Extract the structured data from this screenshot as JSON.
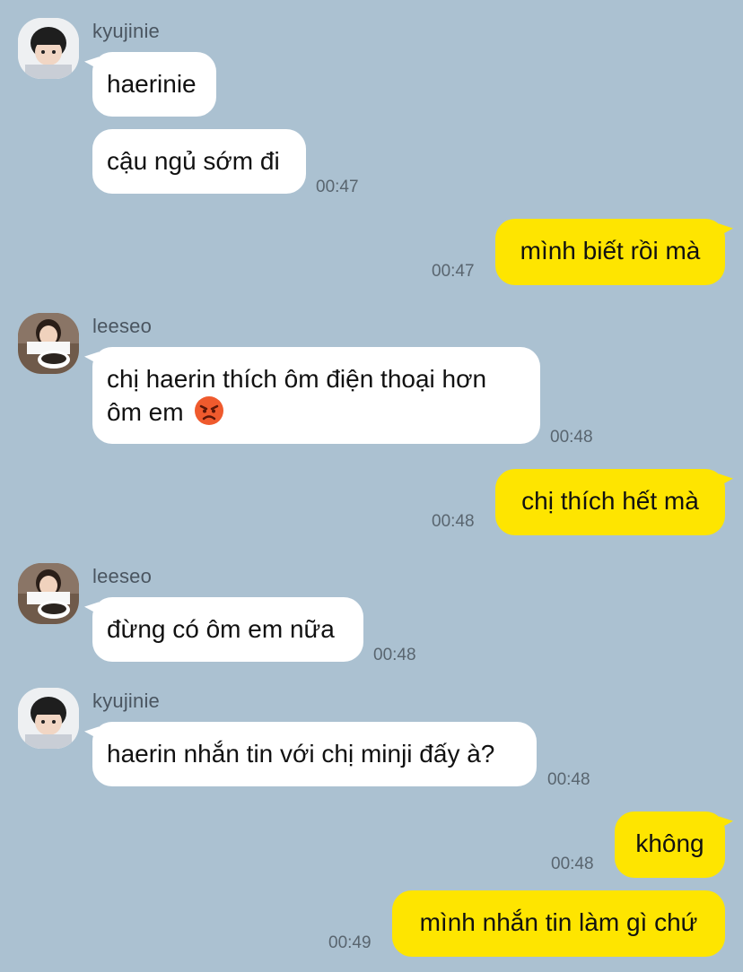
{
  "messages": [
    {
      "sender": "kyujinie",
      "text": "haerinie",
      "time": ""
    },
    {
      "sender": "",
      "text": "cậu ngủ sớm đi",
      "time": "00:47"
    },
    {
      "sender": "me",
      "text": "mình biết rồi mà",
      "time": "00:47"
    },
    {
      "sender": "leeseo",
      "text": "chị haerin thích ôm điện thoại hơn ôm em",
      "time": "00:48",
      "emoji": "angry-face"
    },
    {
      "sender": "me",
      "text": "chị thích hết mà",
      "time": "00:48"
    },
    {
      "sender": "leeseo",
      "text": "đừng có ôm em nữa",
      "time": "00:48"
    },
    {
      "sender": "kyujinie",
      "text": "haerin nhắn tin với chị minji đấy à?",
      "time": "00:48"
    },
    {
      "sender": "me",
      "text": "không",
      "time": "00:48"
    },
    {
      "sender": "me",
      "text": "mình nhắn tin làm gì chứ",
      "time": "00:49"
    }
  ],
  "colors": {
    "background": "#abc1d1",
    "incoming_bubble": "#ffffff",
    "outgoing_bubble": "#fee500"
  }
}
